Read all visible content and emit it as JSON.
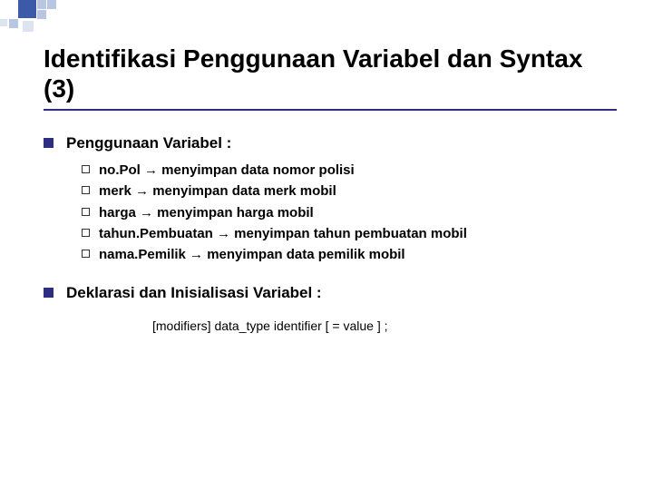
{
  "title": "Identifikasi Penggunaan Variabel dan Syntax (3)",
  "section1": {
    "heading": "Penggunaan Variabel :",
    "items": [
      "no.Pol → menyimpan data nomor polisi",
      "merk → menyimpan data merk mobil",
      "harga → menyimpan harga mobil",
      "tahun.Pembuatan → menyimpan tahun pembuatan mobil",
      "nama.Pemilik → menyimpan data pemilik mobil"
    ]
  },
  "section2": {
    "heading": "Deklarasi dan Inisialisasi Variabel :",
    "code": "[modifiers] data_type identifier [ = value ] ;"
  }
}
